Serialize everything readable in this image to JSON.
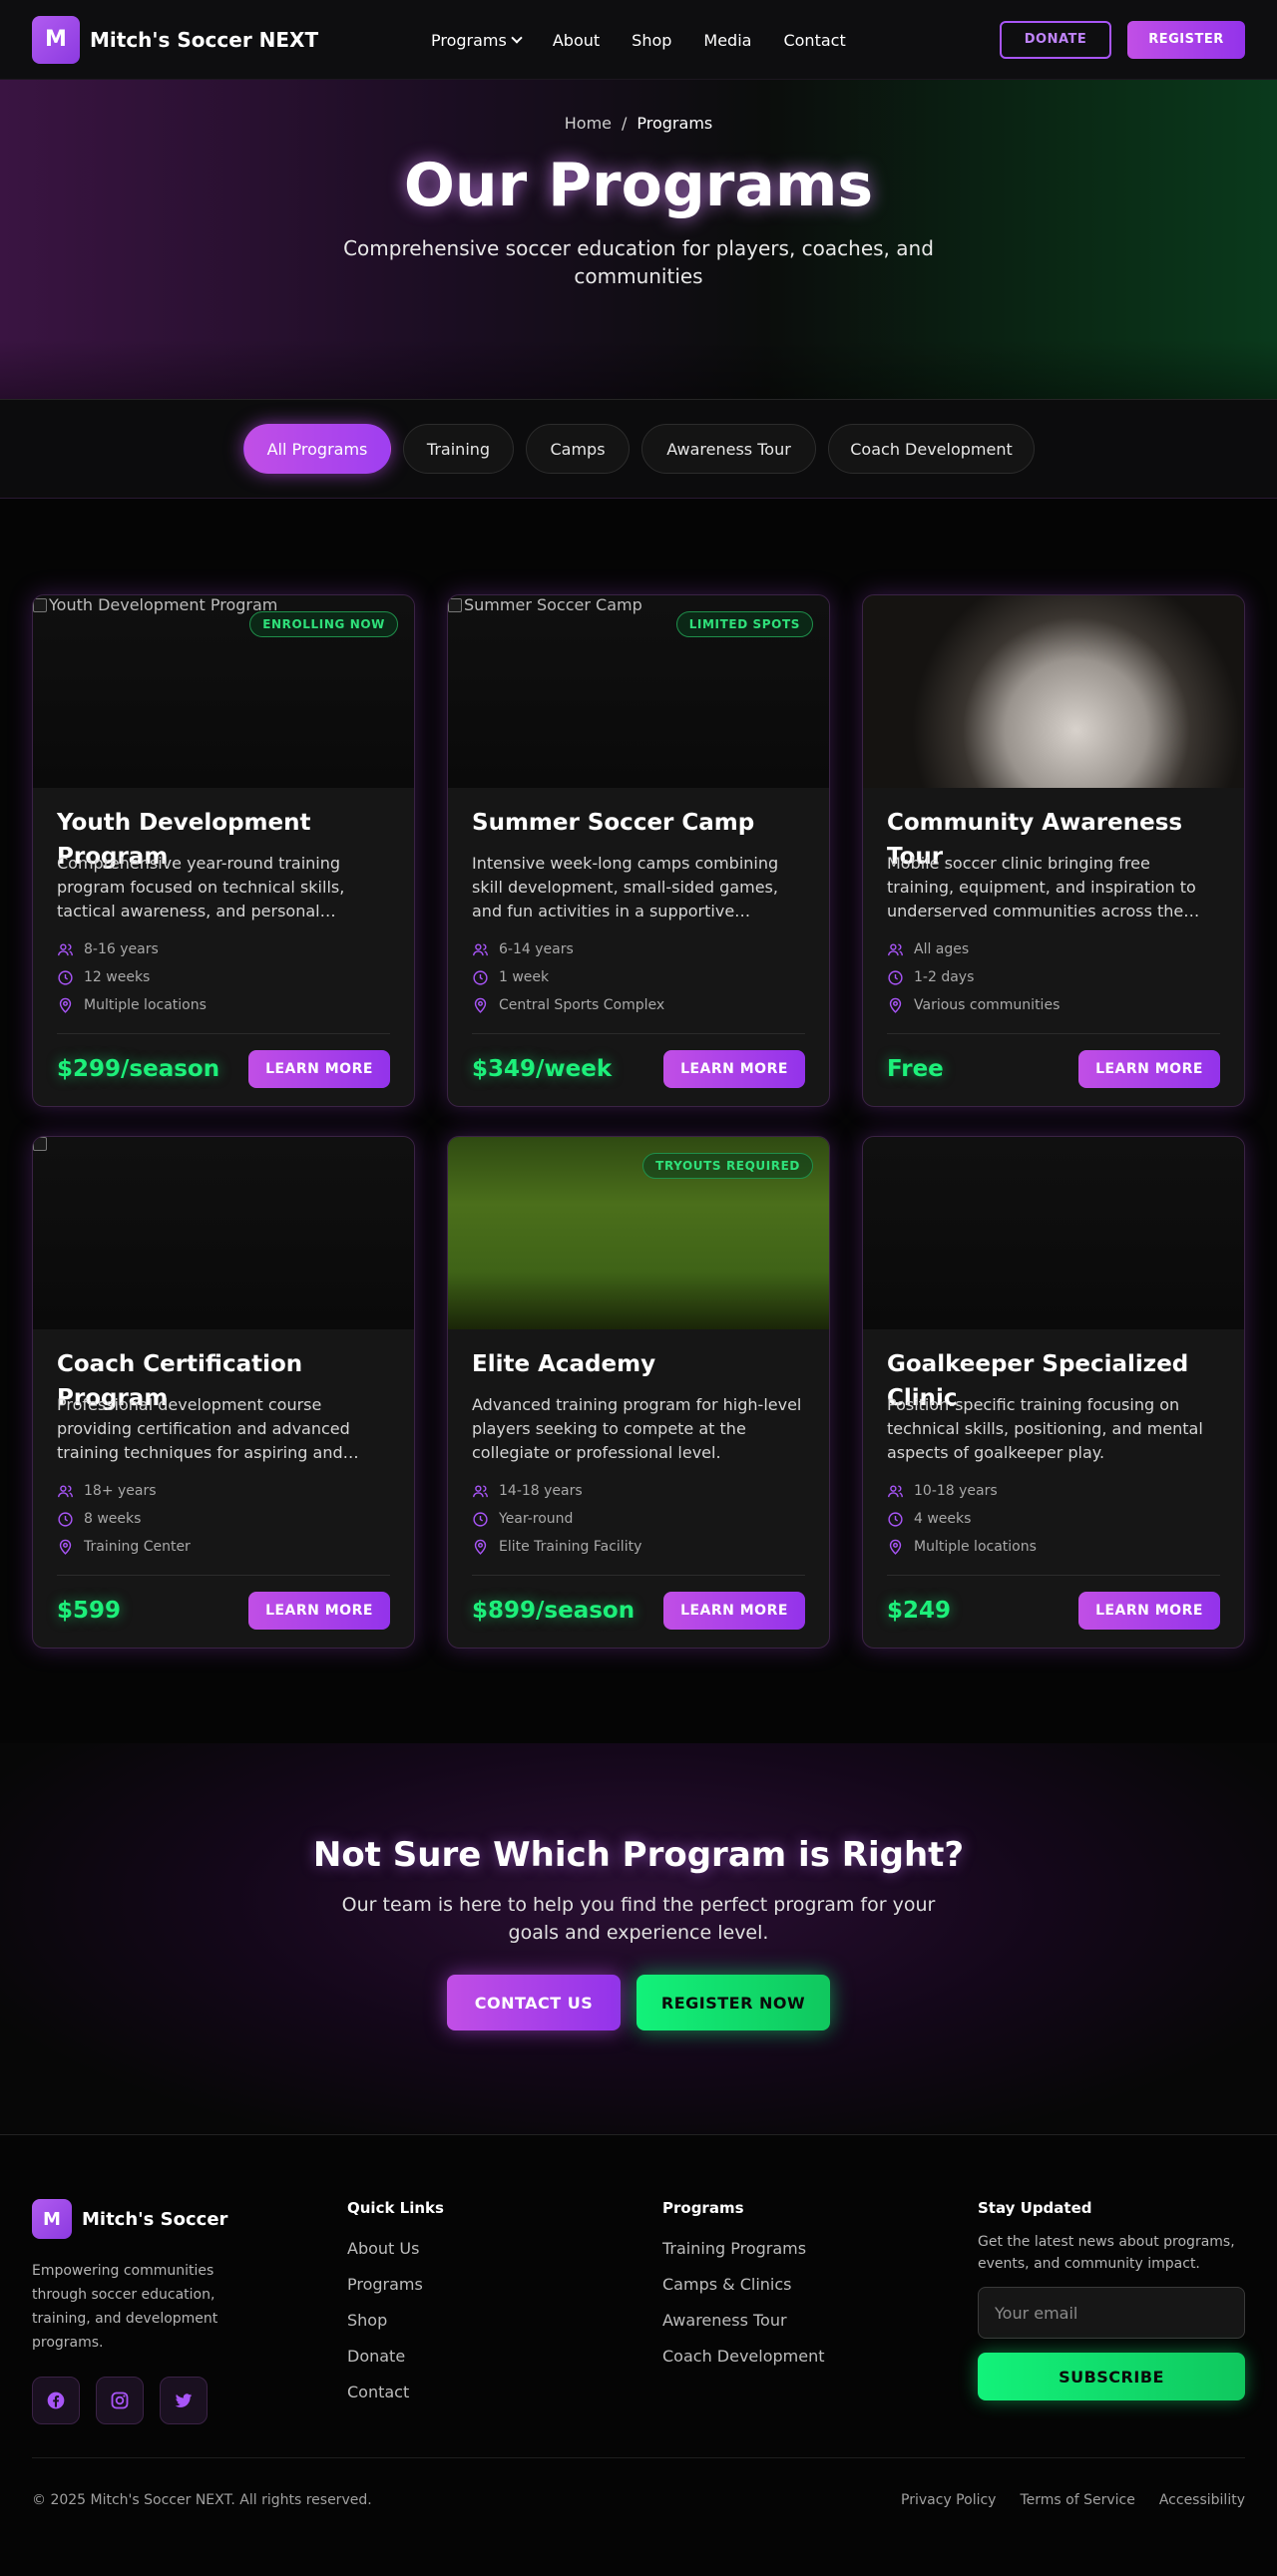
{
  "nav": {
    "logo_letter": "M",
    "brand": "Mitch's Soccer NEXT",
    "links": [
      "Programs",
      "About",
      "Shop",
      "Media",
      "Contact"
    ],
    "donate": "DONATE",
    "register": "REGISTER"
  },
  "hero": {
    "breadcrumb_home": "Home",
    "breadcrumb_sep": "/",
    "breadcrumb_current": "Programs",
    "title": "Our Programs",
    "subtitle": "Comprehensive soccer education for players, coaches, and communities"
  },
  "filters": [
    "All Programs",
    "Training",
    "Camps",
    "Awareness Tour",
    "Coach Development"
  ],
  "cards": [
    {
      "img_alt": "Youth Development Program",
      "badge": "ENROLLING NOW",
      "title": "Youth Development Program",
      "desc": "Comprehensive year-round training program focused on technical skills, tactical awareness, and personal development for players.",
      "age": "8-16 years",
      "duration": "12 weeks",
      "location": "Multiple locations",
      "price": "$299/season",
      "button": "LEARN MORE"
    },
    {
      "img_alt": "Summer Soccer Camp",
      "badge": "LIMITED SPOTS",
      "title": "Summer Soccer Camp",
      "desc": "Intensive week-long camps combining skill development, small-sided games, and fun activities in a supportive environment.",
      "age": "6-14 years",
      "duration": "1 week",
      "location": "Central Sports Complex",
      "price": "$349/week",
      "button": "LEARN MORE"
    },
    {
      "img_alt": "",
      "badge": "",
      "title": "Community Awareness Tour",
      "desc": "Mobile soccer clinic bringing free training, equipment, and inspiration to underserved communities across the region.",
      "age": "All ages",
      "duration": "1-2 days",
      "location": "Various communities",
      "price": "Free",
      "button": "LEARN MORE"
    },
    {
      "img_alt": "",
      "badge": "",
      "title": "Coach Certification Program",
      "desc": "Professional development course providing certification and advanced training techniques for aspiring and experienced coaches.",
      "age": "18+ years",
      "duration": "8 weeks",
      "location": "Training Center",
      "price": "$599",
      "button": "LEARN MORE"
    },
    {
      "img_alt": "",
      "badge": "TRYOUTS REQUIRED",
      "title": "Elite Academy",
      "desc": "Advanced training program for high-level players seeking to compete at the collegiate or professional level.",
      "age": "14-18 years",
      "duration": "Year-round",
      "location": "Elite Training Facility",
      "price": "$899/season",
      "button": "LEARN MORE"
    },
    {
      "img_alt": "",
      "badge": "",
      "title": "Goalkeeper Specialized Clinic",
      "desc": "Position-specific training focusing on technical skills, positioning, and mental aspects of goalkeeper play.",
      "age": "10-18 years",
      "duration": "4 weeks",
      "location": "Multiple locations",
      "price": "$249",
      "button": "LEARN MORE"
    }
  ],
  "cta": {
    "title": "Not Sure Which Program is Right?",
    "text": "Our team is here to help you find the perfect program for your goals and experience level.",
    "contact": "CONTACT US",
    "register": "REGISTER NOW"
  },
  "footer": {
    "logo_letter": "M",
    "brand": "Mitch's Soccer",
    "about": "Empowering communities through soccer education, training, and development programs.",
    "socials": [
      "facebook-icon",
      "instagram-icon",
      "twitter-icon"
    ],
    "quick_title": "Quick Links",
    "quick_links": [
      "About Us",
      "Programs",
      "Shop",
      "Donate",
      "Contact"
    ],
    "programs_title": "Programs",
    "program_links": [
      "Training Programs",
      "Camps & Clinics",
      "Awareness Tour",
      "Coach Development"
    ],
    "news_title": "Stay Updated",
    "news_text": "Get the latest news about programs, events, and community impact.",
    "email_placeholder": "Your email",
    "subscribe": "SUBSCRIBE",
    "copyright": "© 2025 Mitch's Soccer NEXT. All rights reserved.",
    "legal": [
      "Privacy Policy",
      "Terms of Service",
      "Accessibility"
    ]
  },
  "colors": {
    "accent_purple": "#a855f7",
    "accent_green": "#1df07a",
    "background": "#050505"
  }
}
